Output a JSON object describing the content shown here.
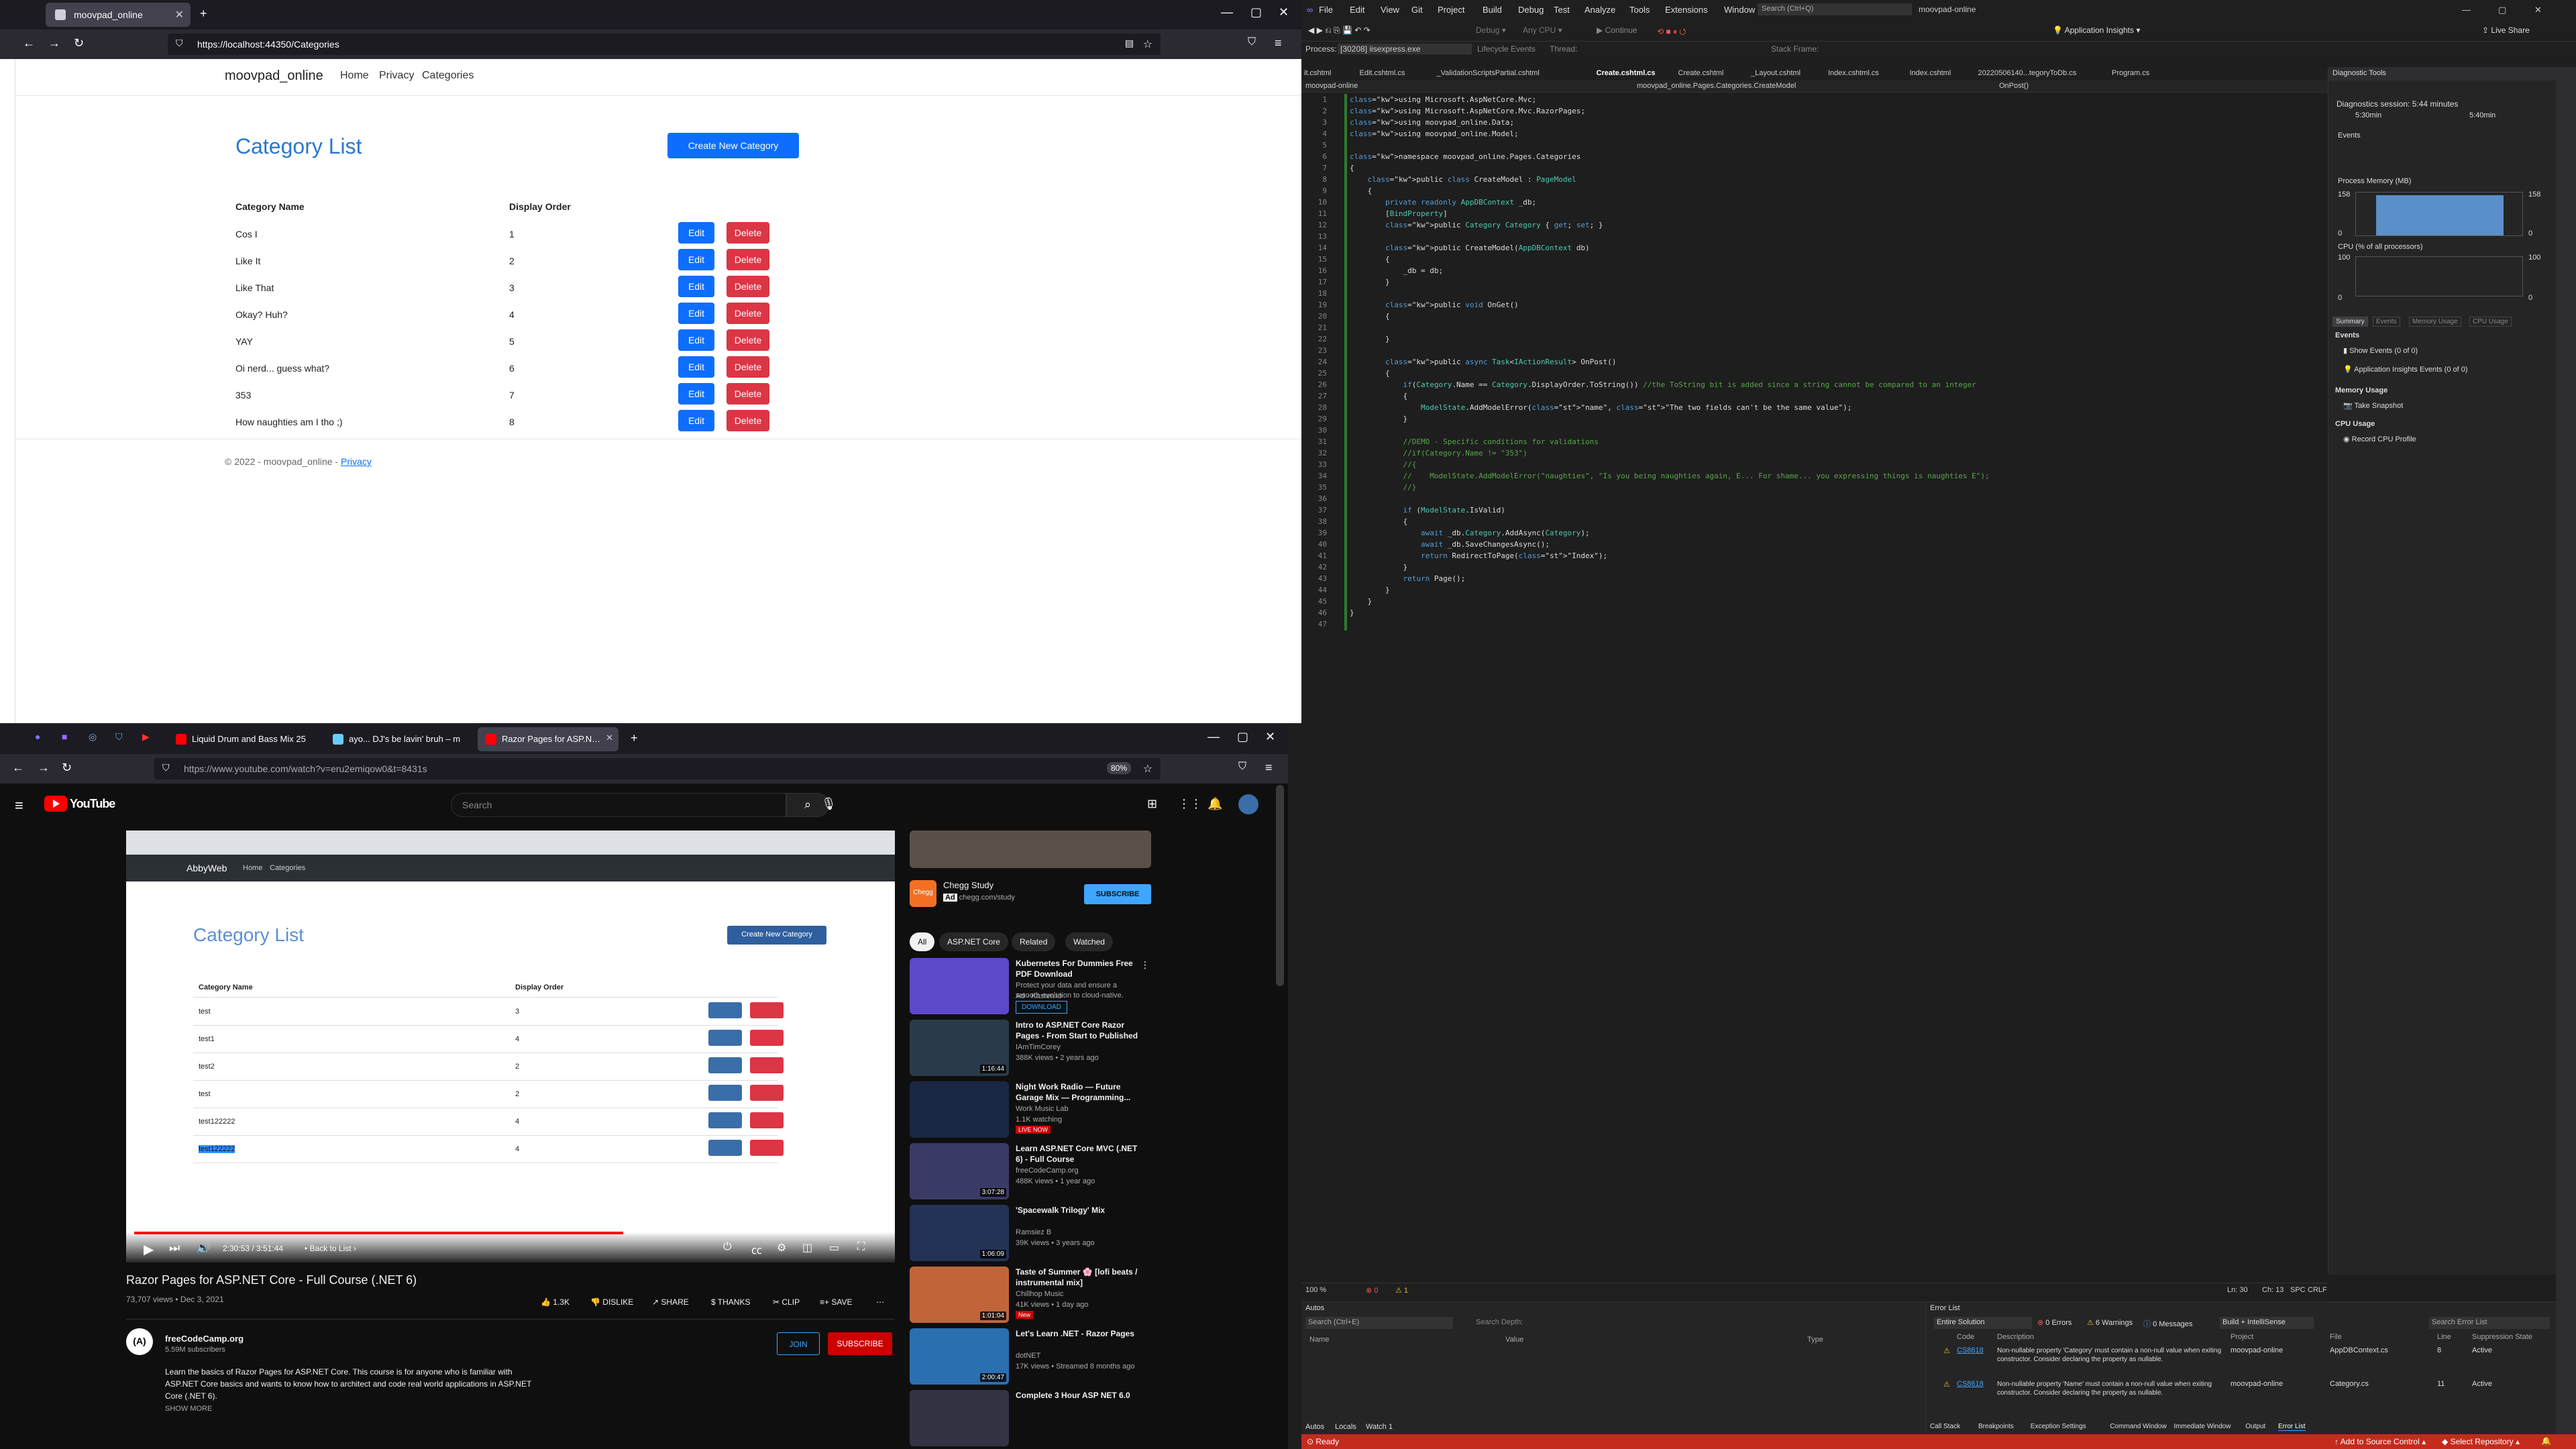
{
  "browser_top": {
    "tab_title": "moovpad_online",
    "url": "https://localhost:44350/Categories",
    "site": {
      "brand": "moovpad_online",
      "nav": [
        "Home",
        "Privacy",
        "Categories"
      ],
      "heading": "Category List",
      "create_button": "Create New Category",
      "columns": [
        "Category Name",
        "Display Order"
      ],
      "edit_label": "Edit",
      "delete_label": "Delete",
      "rows": [
        {
          "name": "Cos I",
          "order": "1"
        },
        {
          "name": "Like It",
          "order": "2"
        },
        {
          "name": "Like That",
          "order": "3"
        },
        {
          "name": "Okay? Huh?",
          "order": "4"
        },
        {
          "name": "YAY",
          "order": "5"
        },
        {
          "name": "Oi nerd... guess what?",
          "order": "6"
        },
        {
          "name": "353",
          "order": "7"
        },
        {
          "name": "How naughties am I tho ;)",
          "order": "8"
        }
      ],
      "footer_text": "© 2022 - moovpad_online - ",
      "footer_link": "Privacy"
    }
  },
  "browser_bottom": {
    "tabs": [
      "Liquid Drum and Bass Mix 25",
      "ayo... DJ's be lavin' bruh – m",
      "Razor Pages for ASP.NET Core"
    ],
    "url": "https://www.youtube.com/watch?v=eru2emiqow0&t=8431s",
    "zoom": "80%",
    "youtube": {
      "logo_text": "YouTube",
      "search_placeholder": "Search",
      "video_title": "Razor Pages for ASP.NET Core - Full Course (.NET 6)",
      "views_date": "73,707 views • Dec 3, 2021",
      "likes": "1.3K",
      "dislike": "DISLIKE",
      "share": "SHARE",
      "thanks": "THANKS",
      "clip": "CLIP",
      "save": "SAVE",
      "channel": "freeCodeCamp.org",
      "subscribers": "5.59M subscribers",
      "join": "JOIN",
      "subscribe": "SUBSCRIBE",
      "description": "Learn the basics of Razor Pages for ASP.NET Core. This course is for anyone who is familiar with ASP.NET Core basics and wants to know how to architect and code real world applications in ASP.NET Core (.NET 6).",
      "show_more": "SHOW MORE",
      "time": "2:30:53 / 3:51:44",
      "chapter": "Back to List",
      "progress": 0.65,
      "video_content": {
        "brand": "AbbyWeb",
        "nav": [
          "Home",
          "Categories"
        ],
        "heading": "Category List",
        "create_button": "Create New Category",
        "columns": [
          "Category Name",
          "Display Order"
        ],
        "rows": [
          {
            "name": "test",
            "order": "3"
          },
          {
            "name": "test1",
            "order": "4"
          },
          {
            "name": "test2",
            "order": "2"
          },
          {
            "name": "test",
            "order": "2"
          },
          {
            "name": "test122222",
            "order": "4"
          },
          {
            "name": "test122222",
            "order": "4"
          }
        ]
      },
      "ad": {
        "title": "Chegg Study",
        "badge": "Ad",
        "domain": "chegg.com/study",
        "cta": "SUBSCRIBE"
      },
      "chips": [
        "All",
        "ASP.NET Core",
        "Related",
        "Watched"
      ],
      "recommendations": [
        {
          "title": "Kubernetes For Dummies Free PDF Download",
          "meta1": "Protect your data and ensure a smooth evolution to cloud-native.",
          "meta2": "Ad · Kasten.io",
          "extra": "DOWNLOAD"
        },
        {
          "title": "Intro to ASP.NET Core Razor Pages - From Start to Published",
          "meta1": "IAmTimCorey",
          "meta2": "388K views • 2 years ago",
          "duration": "1:16:44"
        },
        {
          "title": "Night Work Radio — Future Garage Mix — Programming...",
          "meta1": "Work Music Lab",
          "meta2": "1.1K watching",
          "badge": "LIVE NOW"
        },
        {
          "title": "Learn ASP.NET Core MVC (.NET 6) - Full Course",
          "meta1": "freeCodeCamp.org",
          "meta2": "488K views • 1 year ago",
          "duration": "3:07:28"
        },
        {
          "title": "'Spacewalk Trilogy' Mix",
          "meta1": "Ramsiez B",
          "meta2": "39K views • 3 years ago",
          "duration": "1:06:09"
        },
        {
          "title": "Taste of Summer 🌸 [lofi beats / instrumental mix]",
          "meta1": "Chillhop Music",
          "meta2": "41K views • 1 day ago",
          "duration": "1:01:04",
          "badge": "New"
        },
        {
          "title": "Let's Learn .NET - Razor Pages",
          "meta1": "dotNET",
          "meta2": "17K views • Streamed 8 months ago",
          "duration": "2:00:47"
        },
        {
          "title": "Complete 3 Hour ASP NET 6.0",
          "meta1": "",
          "meta2": ""
        }
      ]
    }
  },
  "vs": {
    "menu": [
      "File",
      "Edit",
      "View",
      "Git",
      "Project",
      "Build",
      "Debug",
      "Test",
      "Analyze",
      "Tools",
      "Extensions",
      "Window",
      "Help"
    ],
    "search": "Search (Ctrl+Q)",
    "solution": "moovpad-online",
    "live_share": "Live Share",
    "process": "[30208] iisexpress.exe",
    "lifecycle": "Lifecycle Events",
    "thread": "Thread:",
    "stack_frame": "Stack Frame:",
    "continue": "Continue",
    "app_insights": "Application Insights",
    "tabs": [
      "it.cshtml",
      "Edit.cshtml.cs",
      "_ValidationScriptsPartial.cshtml",
      "Create.cshtml.cs",
      "Create.cshtml",
      "_Layout.cshtml",
      "Index.cshtml.cs",
      "Index.cshtml",
      "20220506140...tegoryToDb.cs",
      "Program.cs"
    ],
    "crumb_project": "moovpad-online",
    "crumb_class": "moovpad_online.Pages.Categories.CreateModel",
    "crumb_method": "OnPost()",
    "code": [
      "using Microsoft.AspNetCore.Mvc;",
      "using Microsoft.AspNetCore.Mvc.RazorPages;",
      "using moovpad_online.Data;",
      "using moovpad_online.Model;",
      "",
      "namespace moovpad_online.Pages.Categories",
      "{",
      "    public class CreateModel : PageModel",
      "    {",
      "        private readonly AppDBContext _db;",
      "        [BindProperty]",
      "        public Category Category { get; set; }",
      "",
      "        public CreateModel(AppDBContext db)",
      "        {",
      "            _db = db;",
      "        }",
      "",
      "        public void OnGet()",
      "        {",
      "",
      "        }",
      "",
      "        public async Task<IActionResult> OnPost()",
      "        {",
      "            if(Category.Name == Category.DisplayOrder.ToString()) //the ToString bit is added since a string cannot be compared to an integer",
      "            {",
      "                ModelState.AddModelError(\"name\", \"The two fields can't be the same value\");",
      "            }",
      "",
      "            //DEMO - Specific conditions for validations",
      "            //if(Category.Name != \"353\")",
      "            //{",
      "            //    ModelState.AddModelError(\"naughties\", \"Is you being naughties again, E... For shame... you expressing things is naughties E\");",
      "            //}",
      "",
      "            if (ModelState.IsValid)",
      "            {",
      "                await _db.Category.AddAsync(Category);",
      "                await _db.SaveChangesAsync();",
      "                return RedirectToPage(\"Index\");",
      "            }",
      "            return Page();",
      "        }",
      "    }",
      "}",
      ""
    ],
    "diagnostics": {
      "title": "Diagnostic Tools",
      "session": "Diagnostics session: 5:44 minutes",
      "t1": "5:30min",
      "t2": "5:40min",
      "events": "Events",
      "memory": "Process Memory (MB)",
      "mem_max": "158",
      "mem_min": "0",
      "cpu": "CPU (% of all processors)",
      "cpu_max": "100",
      "cpu_min": "0",
      "tabs": [
        "Summary",
        "Events",
        "Memory Usage",
        "CPU Usage"
      ],
      "events_hdr": "Events",
      "show_events": "Show Events (0 of 0)",
      "ai_events": "Application Insights Events (0 of 0)",
      "mem_hdr": "Memory Usage",
      "snapshot": "Take Snapshot",
      "cpu_hdr": "CPU Usage",
      "record": "Record CPU Profile"
    },
    "editor_status": {
      "zoom": "100 %",
      "errors": "0",
      "warnings": "1",
      "ln": "Ln: 30",
      "ch": "Ch: 13",
      "spc": "SPC",
      "crlf": "CRLF"
    },
    "autos": {
      "title": "Autos",
      "search": "Search (Ctrl+E)",
      "depth": "Search Depth:",
      "cols": [
        "Name",
        "Value",
        "Type"
      ],
      "tabs": [
        "Autos",
        "Locals",
        "Watch 1"
      ]
    },
    "errors": {
      "title": "Error List",
      "scope": "Entire Solution",
      "n_errors": "0 Errors",
      "n_warnings": "6 Warnings",
      "n_messages": "0 Messages",
      "build": "Build + IntelliSense",
      "search": "Search Error List",
      "cols": [
        "Code",
        "Description",
        "Project",
        "File",
        "Line",
        "Suppression State"
      ],
      "rows": [
        {
          "code": "CS8618",
          "desc": "Non-nullable property 'Category' must contain a non-null value when exiting constructor. Consider declaring the property as nullable.",
          "project": "moovpad-online",
          "file": "AppDBContext.cs",
          "line": "8",
          "state": "Active"
        },
        {
          "code": "CS8618",
          "desc": "Non-nullable property 'Name' must contain a non-null value when exiting constructor. Consider declaring the property as nullable.",
          "project": "moovpad-online",
          "file": "Category.cs",
          "line": "11",
          "state": "Active"
        }
      ],
      "tabs": [
        "Call Stack",
        "Breakpoints",
        "Exception Settings",
        "Command Window",
        "Immediate Window",
        "Output",
        "Error List"
      ]
    },
    "status": {
      "ready": "Ready",
      "source": "Add to Source Control",
      "repo": "Select Repository"
    }
  }
}
